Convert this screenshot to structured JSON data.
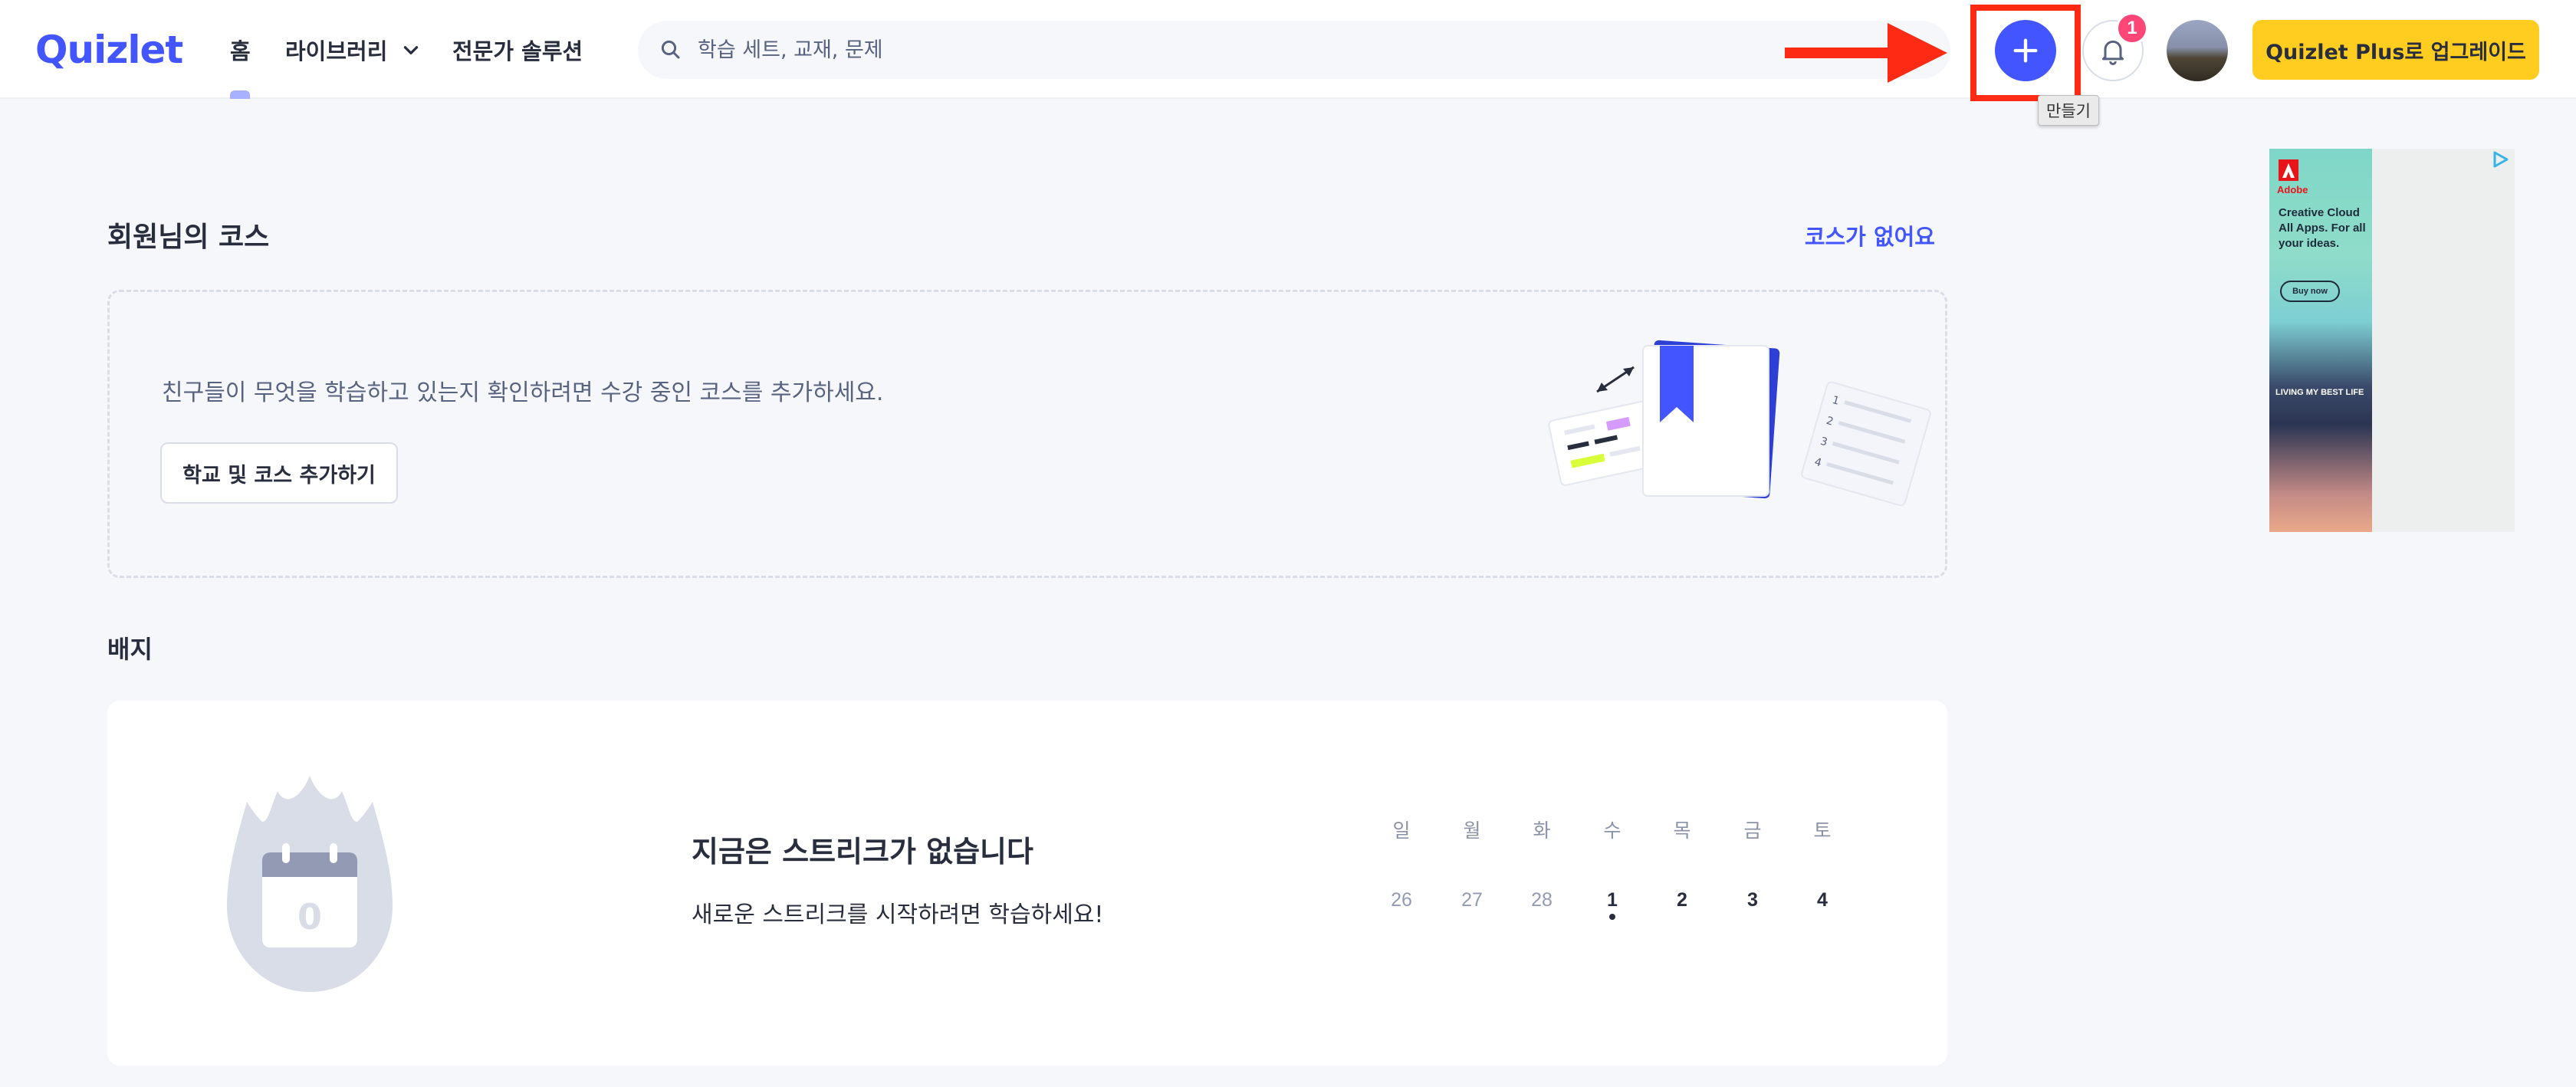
{
  "header": {
    "logo": "Quizlet",
    "nav": {
      "home": "홈",
      "library": "라이브러리",
      "experts": "전문가 솔루션"
    },
    "search": {
      "placeholder": "학습 세트, 교재, 문제"
    },
    "create_tooltip": "만들기",
    "notification_count": "1",
    "upgrade_label": "Quizlet Plus로 업그레이드"
  },
  "courses": {
    "title": "회원님의 코스",
    "no_courses_link": "코스가 없어요",
    "description": "친구들이 무엇을 학습하고 있는지 확인하려면 수강 중인 코스를 추가하세요.",
    "add_button": "학교 및 코스 추가하기"
  },
  "badges": {
    "title": "배지",
    "streak_heading": "지금은 스트리크가 없습니다",
    "streak_sub": "새로운 스트리크를 시작하려면 학습하세요!",
    "streak_count": "0",
    "calendar": {
      "days": [
        "일",
        "월",
        "화",
        "수",
        "목",
        "금",
        "토"
      ],
      "dates": [
        "26",
        "27",
        "28",
        "1",
        "2",
        "3",
        "4"
      ]
    }
  },
  "ad": {
    "brand": "Adobe",
    "text": "Creative Cloud All Apps. For all your ideas.",
    "button": "Buy now",
    "banner": "LIVING MY BEST LIFE"
  },
  "colors": {
    "brand": "#4255ff",
    "upgrade": "#ffcd1f",
    "badge": "#ff4777",
    "annotation": "#ff2a14"
  }
}
